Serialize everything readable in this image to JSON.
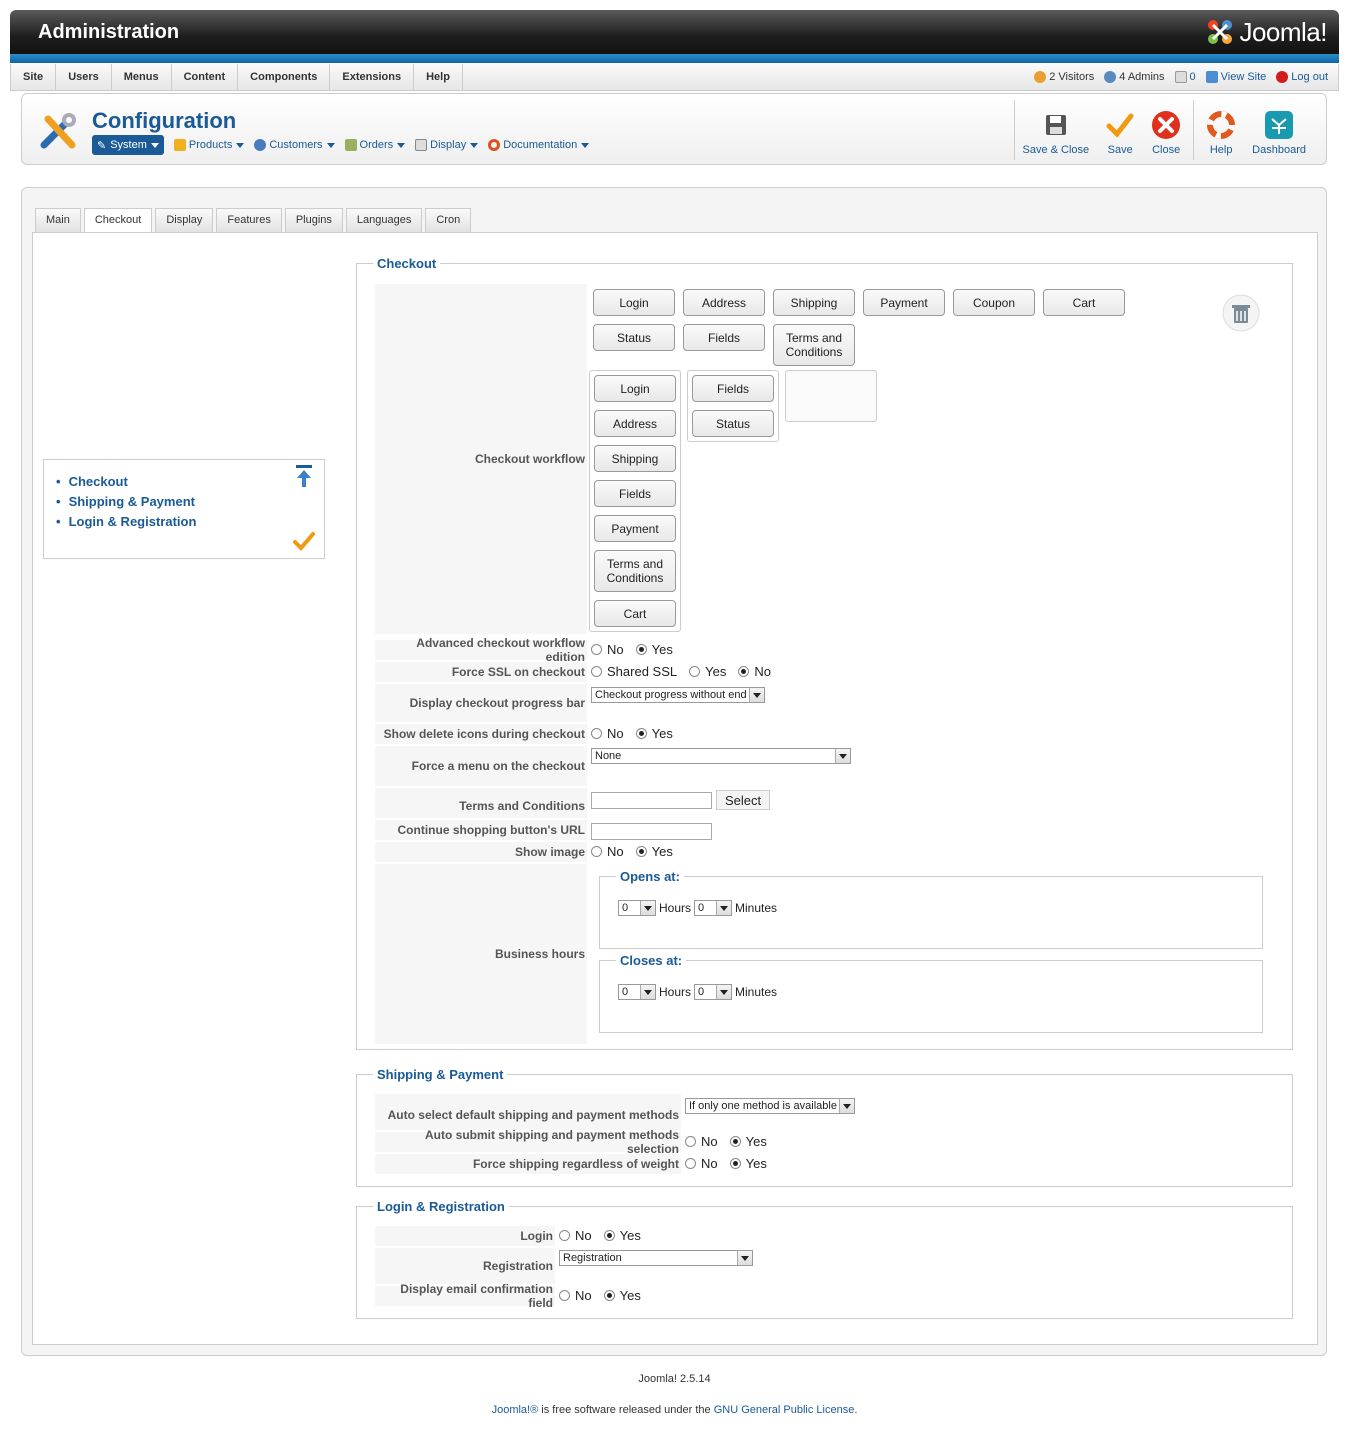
{
  "header": {
    "title": "Administration",
    "logo_text": "Joomla!"
  },
  "menu": {
    "items": [
      "Site",
      "Users",
      "Menus",
      "Content",
      "Components",
      "Extensions",
      "Help"
    ]
  },
  "status": {
    "visitors": "2 Visitors",
    "admins": "4 Admins",
    "messages": "0",
    "view_site": "View Site",
    "logout": "Log out"
  },
  "page": {
    "title": "Configuration"
  },
  "submenu": [
    {
      "label": "System",
      "icon": "tools-icon",
      "active": true
    },
    {
      "label": "Products",
      "icon": "products-icon"
    },
    {
      "label": "Customers",
      "icon": "customers-icon"
    },
    {
      "label": "Orders",
      "icon": "orders-icon"
    },
    {
      "label": "Display",
      "icon": "display-icon"
    },
    {
      "label": "Documentation",
      "icon": "lifebuoy-icon"
    }
  ],
  "toolbar": {
    "save_close": "Save & Close",
    "save": "Save",
    "close": "Close",
    "help": "Help",
    "dashboard": "Dashboard"
  },
  "tabs": [
    "Main",
    "Checkout",
    "Display",
    "Features",
    "Plugins",
    "Languages",
    "Cron"
  ],
  "active_tab": "Checkout",
  "toc": [
    "Checkout",
    "Shipping & Payment",
    "Login & Registration"
  ],
  "checkout": {
    "legend": "Checkout",
    "workflow_label": "Checkout workflow",
    "palette_row1": [
      "Login",
      "Address",
      "Shipping",
      "Payment",
      "Coupon",
      "Cart"
    ],
    "palette_row2": [
      "Status",
      "Fields",
      "Terms and Conditions"
    ],
    "step1": [
      "Login",
      "Address",
      "Shipping",
      "Fields",
      "Payment",
      "Terms and Conditions",
      "Cart"
    ],
    "step2": [
      "Fields",
      "Status"
    ],
    "advanced_label": "Advanced checkout workflow edition",
    "ssl_label": "Force SSL on checkout",
    "progress_label": "Display checkout progress bar",
    "progress_value": "Checkout progress without end",
    "delete_icons_label": "Show delete icons during checkout",
    "menu_label": "Force a menu on the checkout",
    "menu_value": "None",
    "terms_label": "Terms and Conditions",
    "select_button": "Select",
    "continue_label": "Continue shopping button's URL",
    "show_image_label": "Show image",
    "business_label": "Business hours",
    "opens_legend": "Opens at:",
    "closes_legend": "Closes at:",
    "hours_value": "0",
    "minutes_value": "0",
    "hours_label": "Hours",
    "minutes_label": "Minutes"
  },
  "radio": {
    "no": "No",
    "yes": "Yes",
    "shared_ssl": "Shared SSL"
  },
  "shipping": {
    "legend": "Shipping & Payment",
    "auto_select_label": "Auto select default shipping and payment methods",
    "auto_select_value": "If only one method is available",
    "auto_submit_label": "Auto submit shipping and payment methods selection",
    "force_label": "Force shipping regardless of weight"
  },
  "login": {
    "legend": "Login & Registration",
    "login_label": "Login",
    "registration_label": "Registration",
    "registration_value": "Registration",
    "email_label": "Display email confirmation field"
  },
  "footer": {
    "version": "Joomla! 2.5.14",
    "joomla": "Joomla!®",
    "text": " is free software released under the ",
    "license": "GNU General Public License",
    "end": "."
  },
  "colors": {
    "brand_blue": "#1a5a96",
    "header_dark": "#1e1e1e",
    "accent_blue": "#2a8fc9"
  }
}
